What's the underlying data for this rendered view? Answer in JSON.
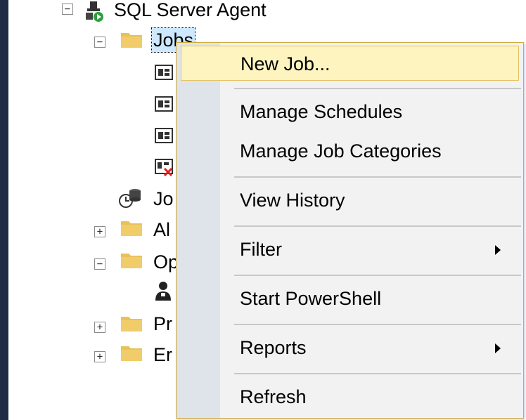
{
  "tree": {
    "agent_label": "SQL Server Agent",
    "jobs_label": "Jobs",
    "job_activity_partial": "Jo",
    "alerts_partial": "Al",
    "operators_partial": "Op",
    "proxies_partial": "Pr",
    "error_logs_partial": "Er"
  },
  "context_menu": {
    "items": [
      {
        "label": "New Job..."
      },
      {
        "label": "Manage Schedules"
      },
      {
        "label": "Manage Job Categories"
      },
      {
        "label": "View History"
      },
      {
        "label": "Filter"
      },
      {
        "label": "Start PowerShell"
      },
      {
        "label": "Reports"
      },
      {
        "label": "Refresh"
      }
    ]
  },
  "colors": {
    "menu_border": "#cfa93a",
    "menu_hover": "#fdf4bf",
    "menu_gutter": "#dfe3ea",
    "folder": "#e8c15a",
    "selection": "#cde8ff"
  }
}
